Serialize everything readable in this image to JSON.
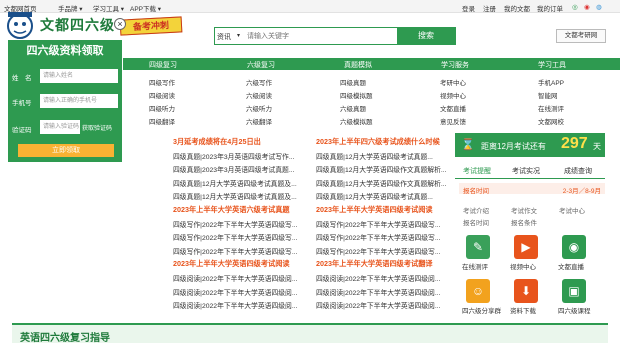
{
  "topbar": {
    "left": [
      "文都网首页",
      "手品牌 ▾",
      "学习工具 ▾",
      "APP下载 ▾"
    ],
    "right": [
      "登录",
      "注册",
      "我的文都",
      "我的订单"
    ]
  },
  "logo": {
    "text": "文都四六级",
    "badge": "备考冲刺"
  },
  "search": {
    "category": "资讯",
    "placeholder": "请输入关键字",
    "button": "搜索",
    "exam_site": "文都考研网"
  },
  "nav": [
    "四级复习",
    "六级复习",
    "真题模拟",
    "学习服务",
    "学习工具"
  ],
  "subnav": [
    [
      "四级写作",
      "四级阅读",
      "四级听力",
      "四级翻译"
    ],
    [
      "六级写作",
      "六级阅读",
      "六级听力",
      "六级翻译"
    ],
    [
      "四级真题",
      "四级模拟题",
      "六级真题",
      "六级模拟题"
    ],
    [
      "考研中心",
      "视频中心",
      "文都直播",
      "意见反馈"
    ],
    [
      "手机APP",
      "智能网",
      "在线测评",
      "文都网校"
    ]
  ],
  "panel": {
    "title": "四六级资料领取",
    "name_label": "姓　名",
    "name_ph": "请输入姓名",
    "phone_label": "手机号",
    "phone_ph": "请输入正确的手机号",
    "code_label": "验证码",
    "code_ph": "请输入验证码",
    "get_code": "获取验证码",
    "submit": "立即领取"
  },
  "news_left": [
    {
      "t": "3月延考成绩将在4月25日出",
      "hl": true
    },
    {
      "t": "四级真题|2023年3月英语四级考试写作..."
    },
    {
      "t": "四级真题|2023年3月英语四级考试真题..."
    },
    {
      "t": "四级真题|12月大学英语四级考试真题及..."
    },
    {
      "t": "四级真题|12月大学英语四级考试真题及..."
    },
    {
      "t": "2023年上半年大学英语六级考试真题",
      "hl": true
    },
    {
      "t": "四级写作|2022年下半年大学英语四级写..."
    },
    {
      "t": "四级写作|2022年下半年大学英语四级写..."
    },
    {
      "t": "四级写作|2022年下半年大学英语四级写..."
    },
    {
      "t": "2023年上半年大学英语四级考试阅读",
      "hl": true
    },
    {
      "t": "四级阅读|2022年下半年大学英语四级阅..."
    },
    {
      "t": "四级阅读|2022年下半年大学英语四级阅..."
    },
    {
      "t": "四级阅读|2022年下半年大学英语四级阅..."
    }
  ],
  "news_right": [
    {
      "t": "2023年上半年四六级考试成绩什么时候",
      "hl": true
    },
    {
      "t": "四级真题|12月大学英语四级考试真题..."
    },
    {
      "t": "四级真题|12月大学英语四级作文真题解析..."
    },
    {
      "t": "四级真题|12月大学英语四级作文真题解析..."
    },
    {
      "t": "四级真题|12月大学英语四级考试真题..."
    },
    {
      "t": "2023年上半年大学英语四级考试阅读",
      "hl": true
    },
    {
      "t": "四级写作|2022年下半年大学英语四级写..."
    },
    {
      "t": "四级写作|2022年下半年大学英语四级写..."
    },
    {
      "t": "四级写作|2022年下半年大学英语四级写..."
    },
    {
      "t": "2023年上半年大学英语四级考试翻译",
      "hl": true
    },
    {
      "t": "四级阅读|2022年下半年大学英语四级阅..."
    },
    {
      "t": "四级阅读|2022年下半年大学英语四级阅..."
    },
    {
      "t": "四级阅读|2022年下半年大学英语四级阅..."
    }
  ],
  "countdown": {
    "prefix": "距离12月考试还有",
    "days": "297",
    "unit": "天"
  },
  "exam_tabs": [
    "考试提醒",
    "考试实况",
    "成绩查询"
  ],
  "reg": {
    "label": "报名时间",
    "value": "2-3月／8-9月"
  },
  "exam_links": [
    "考试介绍",
    "考试作文",
    "考试中心",
    "报名时间",
    "报名条件"
  ],
  "tools": [
    {
      "label": "在线测评",
      "color": "#3aa05a",
      "glyph": "✎"
    },
    {
      "label": "视频中心",
      "color": "#e8541c",
      "glyph": "▶"
    },
    {
      "label": "文都直播",
      "color": "#2e9a50",
      "glyph": "◉"
    },
    {
      "label": "四六级分享群",
      "color": "#f2a21e",
      "glyph": "☺"
    },
    {
      "label": "资料下载",
      "color": "#e8541c",
      "glyph": "⬇"
    },
    {
      "label": "四六级课程",
      "color": "#2e9a50",
      "glyph": "▣"
    }
  ],
  "bottom_title": "英语四六级复习指导"
}
